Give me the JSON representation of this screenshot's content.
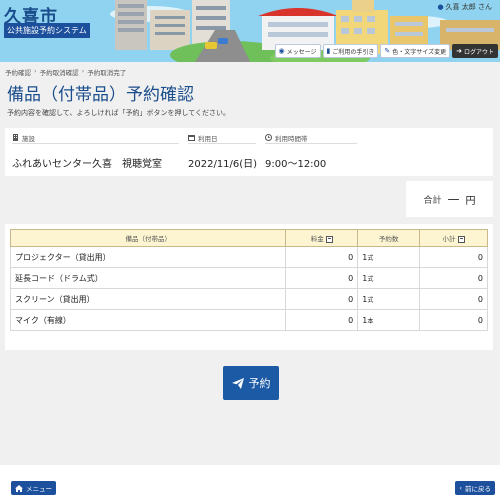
{
  "header": {
    "city": "久喜市",
    "system_name": "公共施設予約システム",
    "user": "久喜 太郎 さん",
    "buttons": [
      {
        "label": "メッセージ",
        "icon": "comment-icon"
      },
      {
        "label": "ご利用の手引き",
        "icon": "book-icon"
      },
      {
        "label": "色・文字サイズ変更",
        "icon": "pencil-icon"
      },
      {
        "label": "ログアウト",
        "icon": "logout-icon"
      }
    ]
  },
  "breadcrumb": [
    "予約確認",
    "予約取消確認",
    "予約取消完了"
  ],
  "page": {
    "title": "備品（付帯品）予約確認",
    "description": "予約内容を確認して、よろしければ「予約」ボタンを押してください。"
  },
  "info": {
    "facility_label": "施設",
    "facility_value": "ふれあいセンター久喜　視聴覚室",
    "date_label": "利用日",
    "date_value": "2022/11/6(日)",
    "time_label": "利用時間帯",
    "time_value": "9:00～12:00"
  },
  "total": {
    "label": "合計",
    "value": "—",
    "unit": "円"
  },
  "table": {
    "headers": [
      "備品（付帯品）",
      "料金",
      "予約数",
      "小計"
    ],
    "rows": [
      {
        "name": "プロジェクター（貸出用）",
        "fee": "0",
        "qty": "1",
        "unit": "式",
        "subtotal": "0"
      },
      {
        "name": "延長コード（ドラム式）",
        "fee": "0",
        "qty": "1",
        "unit": "式",
        "subtotal": "0"
      },
      {
        "name": "スクリーン（貸出用）",
        "fee": "0",
        "qty": "1",
        "unit": "式",
        "subtotal": "0"
      },
      {
        "name": "マイク（有線）",
        "fee": "0",
        "qty": "1",
        "unit": "本",
        "subtotal": "0"
      }
    ]
  },
  "reserve_button": "予約",
  "footer": {
    "menu": "メニュー",
    "back": "前に戻る"
  },
  "colors": {
    "brand": "#1c4f9c",
    "header_sky": "#8fd3f0",
    "table_header": "#fdf5d2"
  }
}
